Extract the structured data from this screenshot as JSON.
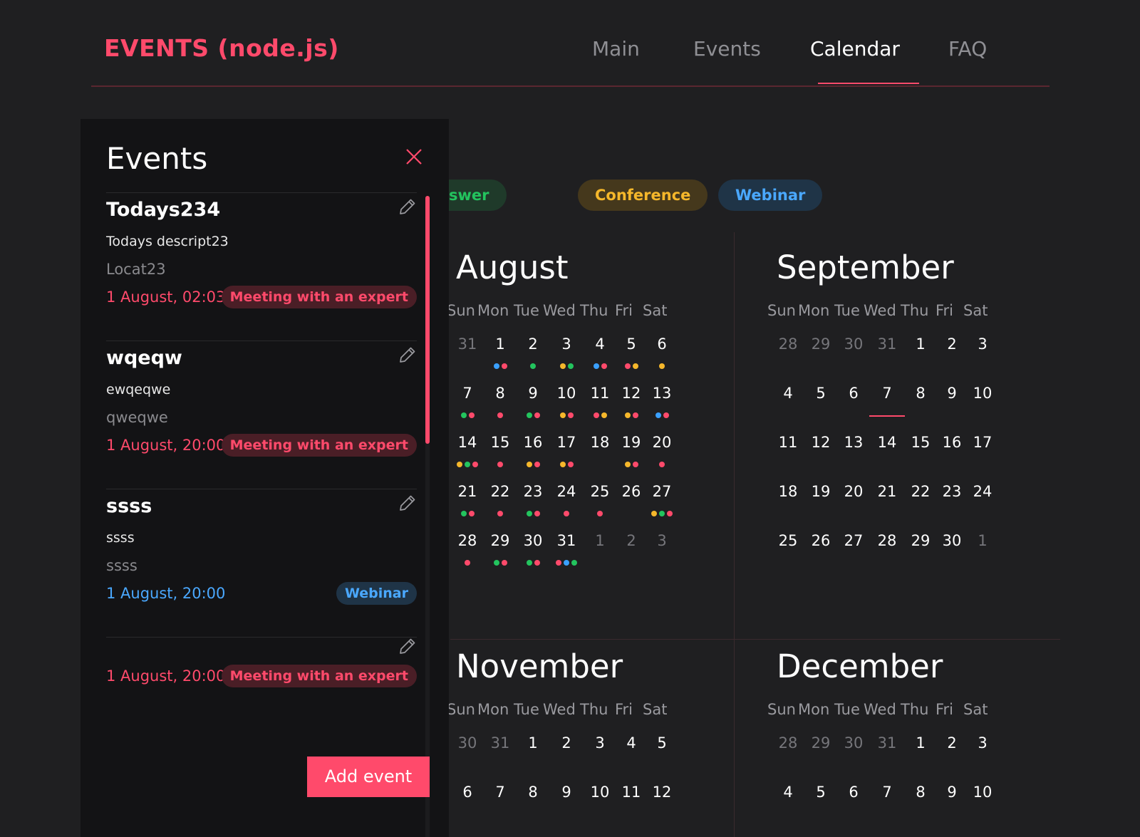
{
  "header": {
    "logo": "EVENTS (node.js)",
    "nav": [
      {
        "label": "Main",
        "active": false
      },
      {
        "label": "Events",
        "active": false
      },
      {
        "label": "Calendar",
        "active": true
      },
      {
        "label": "FAQ",
        "active": false
      }
    ]
  },
  "colors": {
    "accent": "#ff4a6b",
    "green": "#23c45e",
    "yellow": "#f5b72b",
    "blue": "#3aa0ff"
  },
  "tags": [
    {
      "label": "Question-answer",
      "color": "#23c45e",
      "bg": "#1f3a2a"
    },
    {
      "label": "Conference",
      "color": "#f5b72b",
      "bg": "#45381c"
    },
    {
      "label": "Webinar",
      "color": "#4aa8ff",
      "bg": "#1f3447"
    }
  ],
  "weekdays": [
    "Sun",
    "Mon",
    "Tue",
    "Wed",
    "Thu",
    "Fri",
    "Sat"
  ],
  "months": [
    {
      "name": "August",
      "weeks": [
        [
          "31",
          "1",
          "2",
          "3",
          "4",
          "5",
          "6"
        ],
        [
          "7",
          "8",
          "9",
          "10",
          "11",
          "12",
          "13"
        ],
        [
          "14",
          "15",
          "16",
          "17",
          "18",
          "19",
          "20"
        ],
        [
          "21",
          "22",
          "23",
          "24",
          "25",
          "26",
          "27"
        ],
        [
          "28",
          "29",
          "30",
          "31",
          "1",
          "2",
          "3"
        ]
      ],
      "first_week_prev": 1,
      "last_week_next": 3,
      "dots": {
        "0-1": [
          "blue",
          "red"
        ],
        "0-2": [
          "green"
        ],
        "0-3": [
          "yellow",
          "green"
        ],
        "0-4": [
          "blue",
          "red"
        ],
        "0-5": [
          "red",
          "yellow"
        ],
        "0-6": [
          "yellow"
        ],
        "1-0": [
          "green",
          "red"
        ],
        "1-1": [
          "red"
        ],
        "1-2": [
          "green",
          "red"
        ],
        "1-3": [
          "yellow",
          "red"
        ],
        "1-4": [
          "red",
          "yellow"
        ],
        "1-5": [
          "yellow",
          "red"
        ],
        "1-6": [
          "blue",
          "red"
        ],
        "2-0": [
          "yellow",
          "green",
          "red"
        ],
        "2-1": [
          "red"
        ],
        "2-2": [
          "yellow",
          "red"
        ],
        "2-3": [
          "yellow",
          "red"
        ],
        "2-5": [
          "yellow",
          "red"
        ],
        "2-6": [
          "red"
        ],
        "3-0": [
          "green",
          "red"
        ],
        "3-1": [
          "red"
        ],
        "3-2": [
          "green",
          "red"
        ],
        "3-3": [
          "red"
        ],
        "3-4": [
          "red"
        ],
        "3-6": [
          "yellow",
          "green",
          "red"
        ],
        "4-0": [
          "red"
        ],
        "4-1": [
          "green",
          "red"
        ],
        "4-2": [
          "green",
          "red"
        ],
        "4-3": [
          "red",
          "blue",
          "green"
        ]
      }
    },
    {
      "name": "September",
      "weeks": [
        [
          "28",
          "29",
          "30",
          "31",
          "1",
          "2",
          "3"
        ],
        [
          "4",
          "5",
          "6",
          "7",
          "8",
          "9",
          "10"
        ],
        [
          "11",
          "12",
          "13",
          "14",
          "15",
          "16",
          "17"
        ],
        [
          "18",
          "19",
          "20",
          "21",
          "22",
          "23",
          "24"
        ],
        [
          "25",
          "26",
          "27",
          "28",
          "29",
          "30",
          "1"
        ]
      ],
      "first_week_prev": 4,
      "last_week_next": 1,
      "today": "1-3",
      "dots": {}
    },
    {
      "name": "November",
      "weeks": [
        [
          "30",
          "31",
          "1",
          "2",
          "3",
          "4",
          "5"
        ],
        [
          "6",
          "7",
          "8",
          "9",
          "10",
          "11",
          "12"
        ]
      ],
      "first_week_prev": 2,
      "last_week_next": 0,
      "dots": {}
    },
    {
      "name": "December",
      "weeks": [
        [
          "28",
          "29",
          "30",
          "31",
          "1",
          "2",
          "3"
        ],
        [
          "4",
          "5",
          "6",
          "7",
          "8",
          "9",
          "10"
        ]
      ],
      "first_week_prev": 4,
      "last_week_next": 0,
      "dots": {}
    }
  ],
  "panel": {
    "title": "Events",
    "events": [
      {
        "title": "Todays234",
        "desc": "Todays descript23",
        "location": "Locat23",
        "date": "1 August, 02:03",
        "type": "Meeting with an expert",
        "type_color": "#ff4a6b",
        "type_bg": "#4a1e26"
      },
      {
        "title": "wqeqw",
        "desc": "ewqeqwe",
        "location": "qweqwe",
        "date": "1 August, 20:00",
        "type": "Meeting with an expert",
        "type_color": "#ff4a6b",
        "type_bg": "#4a1e26"
      },
      {
        "title": "ssss",
        "desc": "ssss",
        "location": "ssss",
        "date": "1 August, 20:00",
        "type": "Webinar",
        "type_color": "#4aa8ff",
        "type_bg": "#1f3447"
      },
      {
        "title": "",
        "desc": "",
        "location": "",
        "date": "1 August, 20:00",
        "type": "Meeting with an expert",
        "type_color": "#ff4a6b",
        "type_bg": "#4a1e26"
      }
    ],
    "add_button": "Add event"
  }
}
